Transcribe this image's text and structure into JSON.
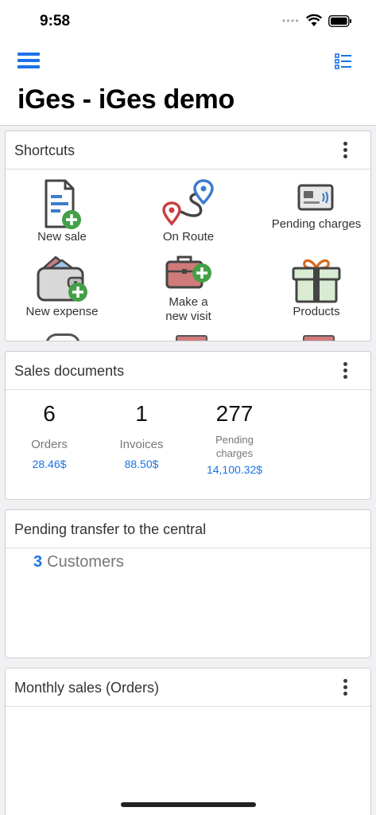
{
  "status": {
    "time": "9:58"
  },
  "header": {
    "title": "iGes - iGes demo"
  },
  "shortcuts": {
    "title": "Shortcuts",
    "items": [
      {
        "label": "New sale",
        "icon": "new-sale-icon"
      },
      {
        "label": "On Route",
        "icon": "route-icon"
      },
      {
        "label": "Pending charges",
        "icon": "card-payment-icon"
      },
      {
        "label": "New expense",
        "icon": "wallet-add-icon"
      },
      {
        "label": "Make a new visit",
        "icon": "briefcase-add-icon"
      },
      {
        "label": "Products",
        "icon": "gift-icon"
      }
    ]
  },
  "sales_documents": {
    "title": "Sales documents",
    "stats": [
      {
        "count": "6",
        "label": "Orders",
        "amount": "28.46$"
      },
      {
        "count": "1",
        "label": "Invoices",
        "amount": "88.50$"
      },
      {
        "count": "277",
        "label": "Pending charges",
        "amount": "14,100.32$"
      }
    ]
  },
  "pending_transfer": {
    "title": "Pending transfer to the central",
    "count": "3",
    "label": "Customers"
  },
  "monthly_sales": {
    "title": "Monthly sales (Orders)"
  },
  "colors": {
    "accent": "#1a73e8",
    "green": "#43a047",
    "red": "#c94040"
  }
}
